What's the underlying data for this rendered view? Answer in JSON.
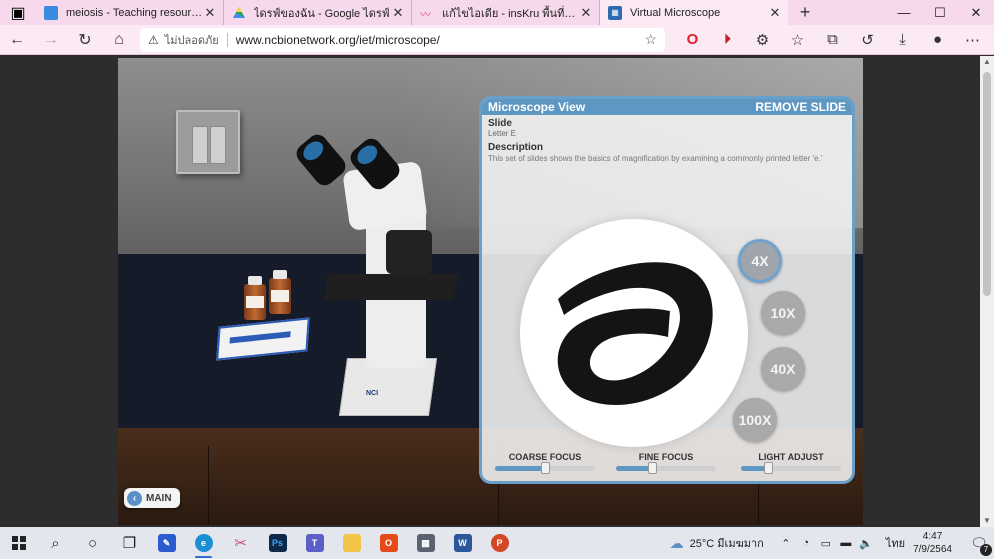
{
  "browser": {
    "tabs": [
      {
        "label": "meiosis - Teaching resources",
        "favicon_color": "#3a8be0",
        "active": false
      },
      {
        "label": "ไดรฟ์ของฉัน - Google ไดรฟ์",
        "favicon_color": "#1fa463",
        "active": false
      },
      {
        "label": "แก้ไขไอเดีย - insKru พื้นที่แบ่งปันไอเดี...",
        "favicon_color": "#e0477a",
        "active": false
      },
      {
        "label": "Virtual Microscope",
        "favicon_color": "#2b6cb0",
        "active": true
      }
    ],
    "new_tab": "+",
    "window_controls": {
      "minimize": "—",
      "maximize": "☐",
      "close": "✕"
    },
    "nav": {
      "back": "←",
      "forward": "→",
      "reload": "↻",
      "home": "⌂"
    },
    "address": {
      "security_label": "ไม่ปลอดภัย",
      "url": "www.ncbionetwork.org/iet/microscope/"
    },
    "toolbar_icons": [
      "opera-icon",
      "media-icon",
      "extensions-icon",
      "favorites-icon",
      "collections-icon",
      "history-icon",
      "downloads-icon",
      "profile-icon",
      "more-icon"
    ]
  },
  "app": {
    "main_button": "MAIN",
    "scene_label": "NCI",
    "panel": {
      "title": "Microscope View",
      "remove_label": "REMOVE SLIDE",
      "slide_heading": "Slide",
      "slide_value": "Letter E",
      "description_heading": "Description",
      "description_text": "This set of slides shows the basics of magnification by examining a commonly printed letter 'e.'",
      "magnifications": [
        {
          "label": "4X",
          "selected": true
        },
        {
          "label": "10X",
          "selected": false
        },
        {
          "label": "40X",
          "selected": false
        },
        {
          "label": "100X",
          "selected": false
        }
      ],
      "sliders": [
        {
          "label": "COARSE FOCUS",
          "value": 0.5
        },
        {
          "label": "FINE FOCUS",
          "value": 0.36
        },
        {
          "label": "LIGHT ADJUST",
          "value": 0.27
        }
      ]
    }
  },
  "taskbar": {
    "icons": [
      "start-icon",
      "search-icon",
      "cortana-icon",
      "task-view-icon",
      "whiteboard-icon",
      "edge-icon",
      "snip-icon",
      "photoshop-icon",
      "teams-icon",
      "file-explorer-icon",
      "office-icon",
      "calculator-icon",
      "word-icon",
      "powerpoint-icon"
    ],
    "weather": "25°C มีเมฆมาก",
    "language": "ไทย",
    "time": "4:47",
    "date": "7/9/2564",
    "notifications": "7"
  }
}
